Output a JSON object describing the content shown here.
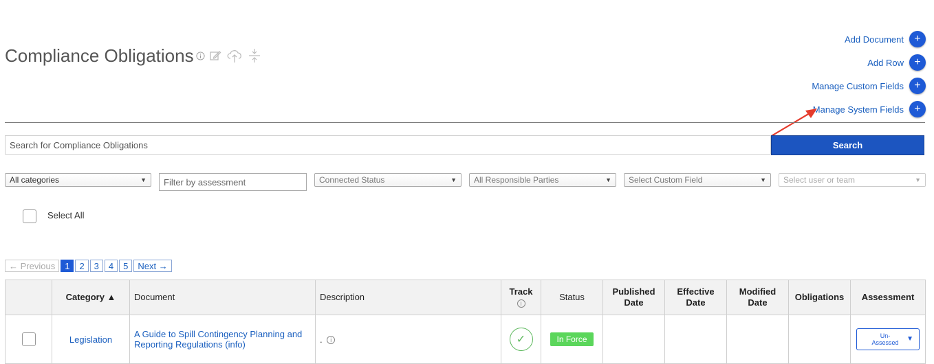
{
  "page": {
    "title": "Compliance Obligations"
  },
  "title_icons": [
    "info-icon",
    "edit-icon",
    "cloud-upload-icon",
    "collapse-icon"
  ],
  "actions": [
    {
      "label": "Add Document",
      "icon": "plus-icon"
    },
    {
      "label": "Add Row",
      "icon": "plus-icon"
    },
    {
      "label": "Manage Custom Fields",
      "icon": "plus-icon"
    },
    {
      "label": "Manage System Fields",
      "icon": "plus-icon"
    }
  ],
  "search": {
    "placeholder": "Search for Compliance Obligations",
    "button_label": "Search"
  },
  "filters": {
    "category": "All categories",
    "assessment_placeholder": "Filter by assessment",
    "connected_status": "Connected Status",
    "responsible_parties": "All Responsible Parties",
    "custom_field": "Select Custom Field",
    "user_team": "Select user or team"
  },
  "select_all": {
    "label": "Select All"
  },
  "pagination": {
    "previous": "← Previous",
    "pages": [
      "1",
      "2",
      "3",
      "4",
      "5"
    ],
    "current": "1",
    "next": "Next →"
  },
  "table": {
    "headers": {
      "category": "Category ▲",
      "document": "Document",
      "description": "Description",
      "track": "Track",
      "status": "Status",
      "published_date": "Published Date",
      "effective_date": "Effective Date",
      "modified_date": "Modified Date",
      "obligations": "Obligations",
      "assessment": "Assessment"
    },
    "rows": [
      {
        "category": "Legislation",
        "document": "A Guide to Spill Contingency Planning and Reporting Regulations (info)",
        "description": ".",
        "status": "In Force",
        "published_date": "",
        "effective_date": "",
        "modified_date": "",
        "obligations": "",
        "assessment": "Un-Assessed"
      }
    ]
  },
  "colors": {
    "accent": "#1e5ad6",
    "link": "#1a5fbf",
    "status_in_force": "#5bd65b",
    "annotation_arrow": "#e53b2c"
  }
}
